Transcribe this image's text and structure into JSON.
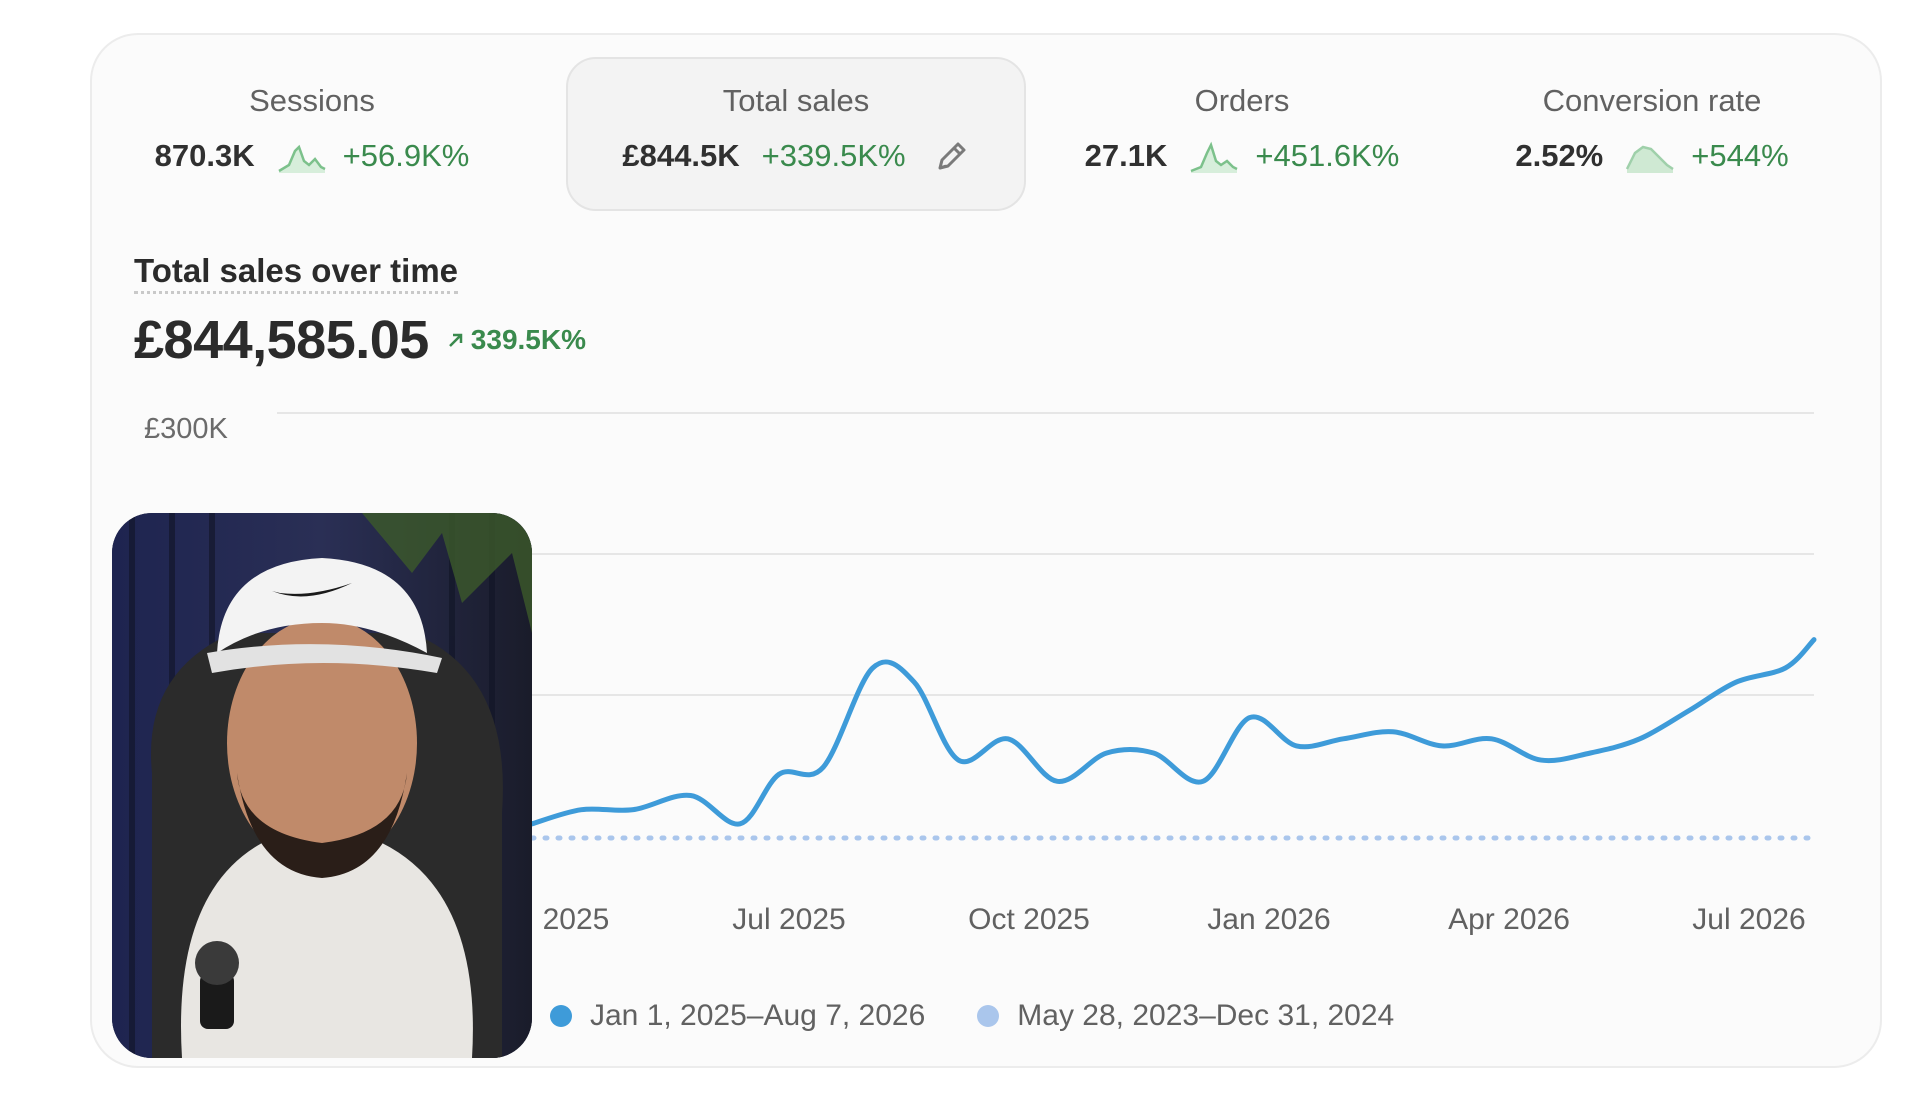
{
  "metrics": [
    {
      "title": "Sessions",
      "value": "870.3K",
      "delta": "+56.9K%",
      "selected": false
    },
    {
      "title": "Total sales",
      "value": "£844.5K",
      "delta": "+339.5K%",
      "selected": true
    },
    {
      "title": "Orders",
      "value": "27.1K",
      "delta": "+451.6K%",
      "selected": false
    },
    {
      "title": "Conversion rate",
      "value": "2.52%",
      "delta": "+544%",
      "selected": false
    }
  ],
  "chart_header": {
    "title": "Total sales over time",
    "total": "£844,585.05",
    "delta": "339.5K%"
  },
  "colors": {
    "primary_series": "#3e9bd9",
    "comparison_series": "#aac6ec",
    "positive": "#3a8a4d",
    "sparkline_fill": "#cfe9d3"
  },
  "chart_data": {
    "type": "line",
    "y_tick_labels": [
      "£300K"
    ],
    "ylim": [
      0,
      300000
    ],
    "x_tick_labels": [
      "2025",
      "Jul 2025",
      "Oct 2025",
      "Jan 2026",
      "Apr 2026",
      "Jul 2026"
    ],
    "series": [
      {
        "name": "Jan 1, 2025–Aug 7, 2026",
        "x": [
          "2025-04",
          "2025-04-20",
          "2025-05-10",
          "2025-06-01",
          "2025-06-20",
          "2025-07-05",
          "2025-07-22",
          "2025-08-10",
          "2025-08-26",
          "2025-09-12",
          "2025-10-01",
          "2025-10-20",
          "2025-11-08",
          "2025-11-26",
          "2025-12-15",
          "2026-01-02",
          "2026-01-20",
          "2026-02-07",
          "2026-02-26",
          "2026-03-17",
          "2026-04-05",
          "2026-04-24",
          "2026-05-13",
          "2026-06-01",
          "2026-06-20",
          "2026-07-08",
          "2026-07-27",
          "2026-08-07"
        ],
        "values": [
          10000,
          20000,
          20000,
          30000,
          10000,
          45000,
          50000,
          120000,
          110000,
          55000,
          70000,
          40000,
          60000,
          60000,
          40000,
          85000,
          65000,
          70000,
          75000,
          65000,
          70000,
          55000,
          60000,
          70000,
          90000,
          110000,
          120000,
          140000
        ]
      },
      {
        "name": "May 28, 2023–Dec 31, 2024",
        "x": [
          "2025-04",
          "2026-08-07"
        ],
        "values": [
          0,
          0
        ]
      }
    ],
    "grid": true,
    "legend_position": "bottom"
  }
}
